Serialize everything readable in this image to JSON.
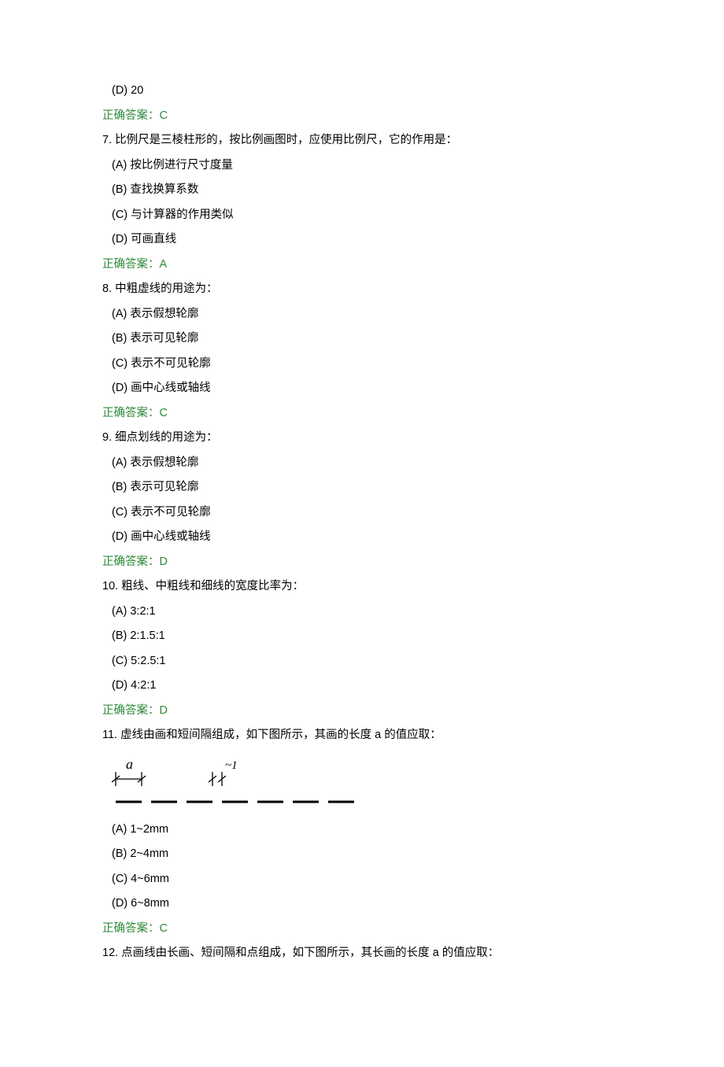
{
  "q6": {
    "optD": "(D) 20",
    "answer": "正确答案：C"
  },
  "q7": {
    "stem": "7. 比例尺是三棱柱形的，按比例画图时，应使用比例尺，它的作用是：",
    "optA": "(A) 按比例进行尺寸度量",
    "optB": "(B) 查找换算系数",
    "optC": "(C) 与计算器的作用类似",
    "optD": "(D) 可画直线",
    "answer": "正确答案：A"
  },
  "q8": {
    "stem": "8. 中粗虚线的用途为：",
    "optA": "(A) 表示假想轮廓",
    "optB": "(B) 表示可见轮廓",
    "optC": "(C) 表示不可见轮廓",
    "optD": "(D) 画中心线或轴线",
    "answer": "正确答案：C"
  },
  "q9": {
    "stem": "9. 细点划线的用途为：",
    "optA": "(A) 表示假想轮廓",
    "optB": "(B) 表示可见轮廓",
    "optC": "(C) 表示不可见轮廓",
    "optD": "(D) 画中心线或轴线",
    "answer": "正确答案：D"
  },
  "q10": {
    "stem": "10. 粗线、中粗线和细线的宽度比率为：",
    "optA": "(A) 3:2:1",
    "optB": "(B) 2:1.5:1",
    "optC": "(C) 5:2.5:1",
    "optD": "(D) 4:2:1",
    "answer": "正确答案：D"
  },
  "q11": {
    "stem": "11. 虚线由画和短间隔组成，如下图所示，其画的长度 a 的值应取：",
    "label_a": "a",
    "label_one": "~1",
    "optA": "(A) 1~2mm",
    "optB": "(B) 2~4mm",
    "optC": "(C) 4~6mm",
    "optD": "(D) 6~8mm",
    "answer": "正确答案：C"
  },
  "q12": {
    "stem": "12. 点画线由长画、短间隔和点组成，如下图所示，其长画的长度 a 的值应取："
  }
}
